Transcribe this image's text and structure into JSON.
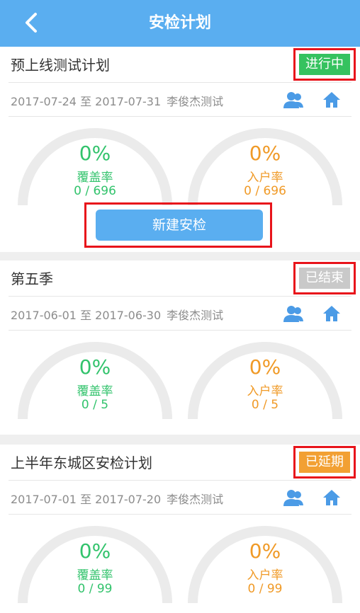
{
  "header": {
    "title": "安检计划",
    "back_icon": "chevron-left-icon"
  },
  "colors": {
    "header_bg": "#5aaef0",
    "green": "#32c36c",
    "orange": "#f09a27",
    "grey": "#c9c9c9",
    "highlight": "#e8141b"
  },
  "plans": [
    {
      "title": "预上线测试计划",
      "status": "进行中",
      "status_color": "#35c25f",
      "dates": "2017-07-24 至 2017-07-31",
      "owner": "李俊杰测试",
      "coverage": {
        "percent": "0%",
        "label": "覆盖率",
        "count": "0 / 696"
      },
      "household": {
        "percent": "0%",
        "label": "入户率",
        "count": "0 / 696"
      },
      "action": "新建安检"
    },
    {
      "title": "第五季",
      "status": "已结束",
      "status_color": "#c9c9c9",
      "dates": "2017-06-01 至 2017-06-30",
      "owner": "李俊杰测试",
      "coverage": {
        "percent": "0%",
        "label": "覆盖率",
        "count": "0 / 5"
      },
      "household": {
        "percent": "0%",
        "label": "入户率",
        "count": "0 / 5"
      }
    },
    {
      "title": "上半年东城区安检计划",
      "status": "已延期",
      "status_color": "#f2a033",
      "dates": "2017-07-01 至 2017-07-20",
      "owner": "李俊杰测试",
      "coverage": {
        "percent": "0%",
        "label": "覆盖率",
        "count": "0 / 99"
      },
      "household": {
        "percent": "0%",
        "label": "入户率",
        "count": "0 / 99"
      }
    }
  ]
}
